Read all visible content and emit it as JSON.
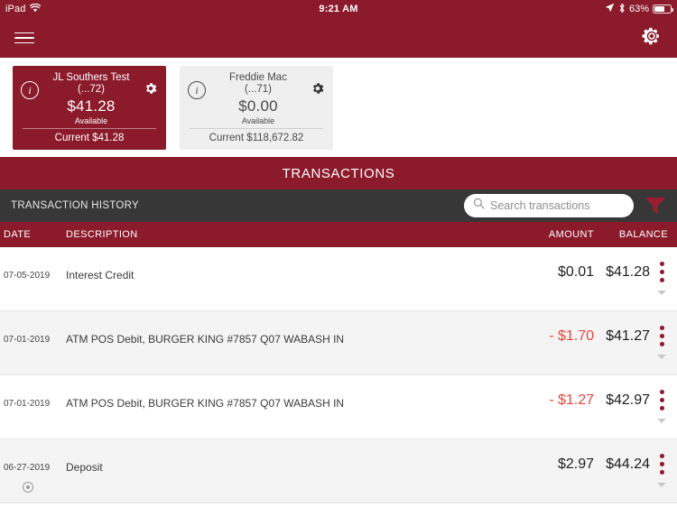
{
  "status_bar": {
    "device": "iPad",
    "wifi_icon": "wifi-icon",
    "time": "9:21 AM",
    "location_icon": "location-arrow-icon",
    "bluetooth_icon": "bluetooth-icon",
    "battery_percent": "63%",
    "battery_level": 63
  },
  "nav": {
    "menu_icon": "hamburger-menu-icon",
    "settings_icon": "gear-icon"
  },
  "accounts": [
    {
      "name": "JL Southers Test",
      "mask": "(...72)",
      "available_amount": "$41.28",
      "available_label": "Available",
      "current": "Current $41.28",
      "info_icon": "info-icon",
      "gear_icon": "gear-icon",
      "selected": true
    },
    {
      "name": "Freddie Mac",
      "mask": "(...71)",
      "available_amount": "$0.00",
      "available_label": "Available",
      "current": "Current $118,672.82",
      "info_icon": "info-icon",
      "gear_icon": "gear-icon",
      "selected": false
    }
  ],
  "transactions_panel": {
    "title": "TRANSACTIONS",
    "history_label": "TRANSACTION HISTORY",
    "search": {
      "placeholder": "Search transactions",
      "value": "",
      "icon": "search-icon"
    },
    "filter_icon": "filter-funnel-icon",
    "columns": {
      "date": "DATE",
      "description": "DESCRIPTION",
      "amount": "AMOUNT",
      "balance": "BALANCE"
    },
    "rows": [
      {
        "date": "07-05-2019",
        "description": "Interest Credit",
        "amount": "$0.01",
        "negative": false,
        "balance": "$41.28",
        "has_attachment": false
      },
      {
        "date": "07-01-2019",
        "description": "ATM POS Debit, BURGER KING #7857 Q07 WABASH IN",
        "amount": "- $1.70",
        "negative": true,
        "balance": "$41.27",
        "has_attachment": false
      },
      {
        "date": "07-01-2019",
        "description": "ATM POS Debit, BURGER KING #7857 Q07 WABASH IN",
        "amount": "- $1.27",
        "negative": true,
        "balance": "$42.97",
        "has_attachment": false
      },
      {
        "date": "06-27-2019",
        "description": "Deposit",
        "amount": "$2.97",
        "negative": false,
        "balance": "$44.24",
        "has_attachment": true
      }
    ],
    "row_menu_icon": "three-dot-menu-icon",
    "row_expand_icon": "chevron-down-icon",
    "attachment_icon": "attachment-circle-icon"
  },
  "colors": {
    "brand_maroon": "#8B1A2B",
    "dark_bar": "#373737",
    "negative_red": "#E8453C",
    "card_inactive": "#EFEFEF",
    "row_alt": "#F4F4F4"
  }
}
